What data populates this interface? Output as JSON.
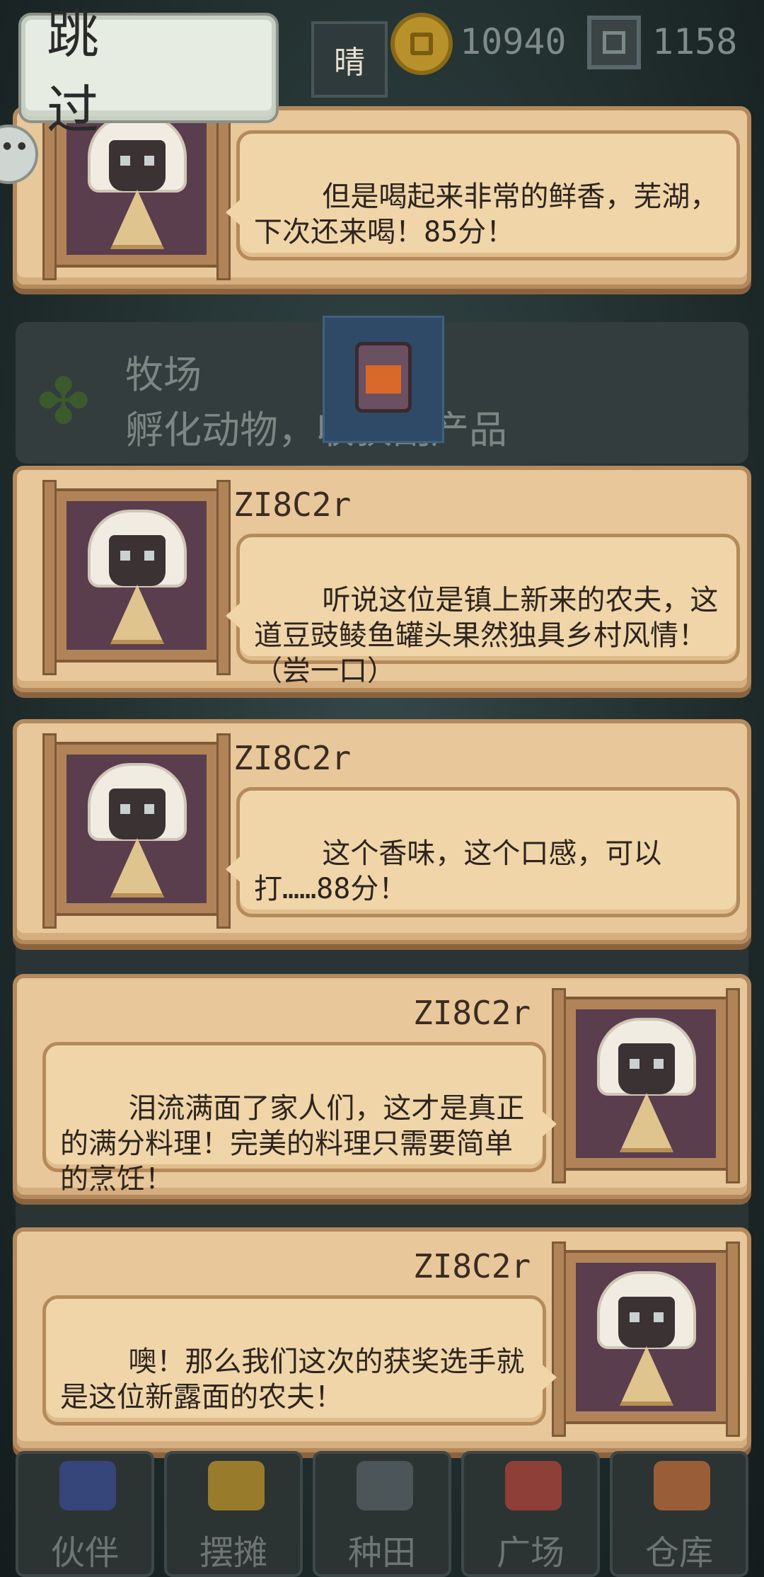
{
  "hud": {
    "skip_label": "跳 过",
    "weather": "晴",
    "gold": "10940",
    "gems": "1158"
  },
  "background": {
    "ranch_title": "牧场",
    "ranch_desc": "孵化动物，收获副产品"
  },
  "dialogues": [
    {
      "speaker": "",
      "text": "但是喝起来非常的鲜香，芜湖，下次还来喝！85分！"
    },
    {
      "speaker": "ZI8C2r",
      "text": "听说这位是镇上新来的农夫，这道豆豉鲮鱼罐头果然独具乡村风情！（尝一口）"
    },
    {
      "speaker": "ZI8C2r",
      "text": "这个香味，这个口感，可以打……88分！"
    },
    {
      "speaker": "ZI8C2r",
      "text": "泪流满面了家人们，这才是真正的满分料理！完美的料理只需要简单的烹饪！"
    },
    {
      "speaker": "ZI8C2r",
      "text": "噢！那么我们这次的获奖选手就是这位新露面的农夫！"
    }
  ],
  "bottom_nav": [
    {
      "label": "伙伴",
      "icon": "partners-icon",
      "color": "#3b4f9a"
    },
    {
      "label": "摆摊",
      "icon": "stall-icon",
      "color": "#c89a2a"
    },
    {
      "label": "种田",
      "icon": "watering-can-icon",
      "color": "#5a6466"
    },
    {
      "label": "广场",
      "icon": "plaza-flower-icon",
      "color": "#b8453a"
    },
    {
      "label": "仓库",
      "icon": "warehouse-icon",
      "color": "#c8703a"
    }
  ]
}
